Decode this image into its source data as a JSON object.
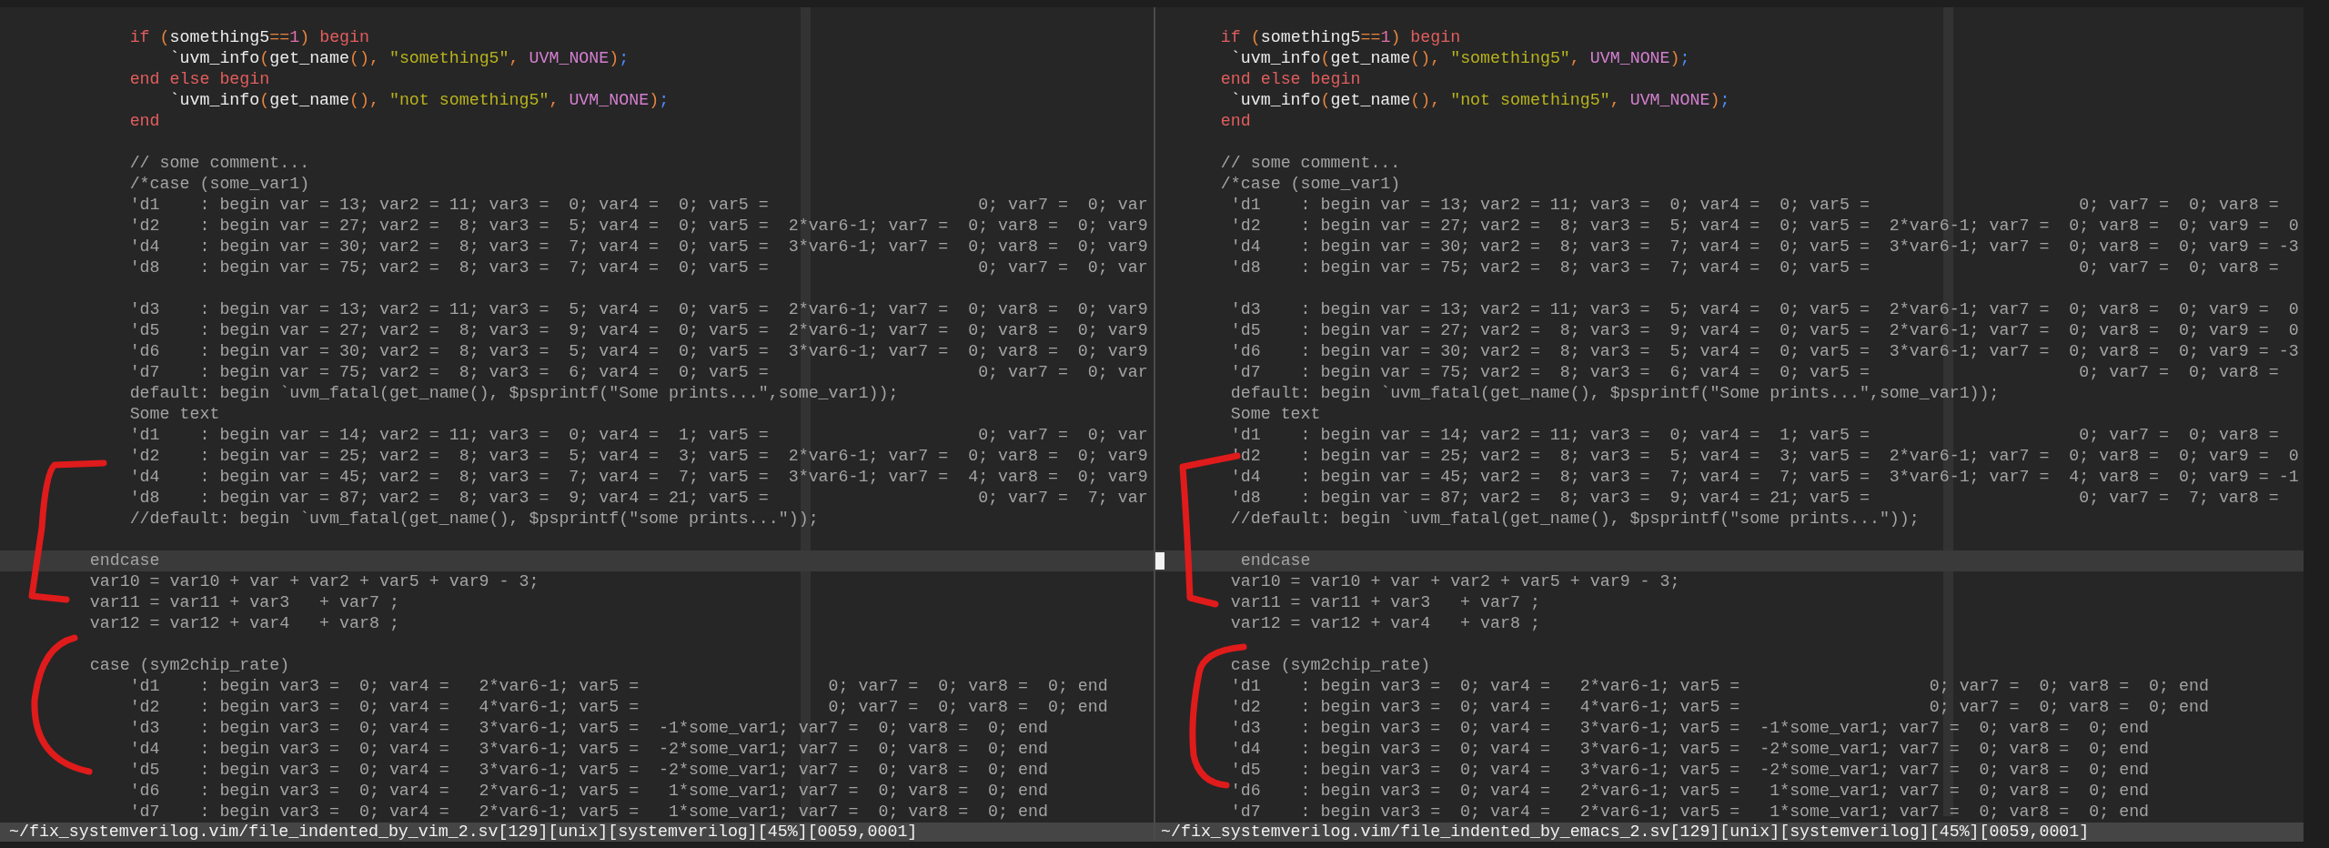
{
  "panes": [
    {
      "active": false,
      "lines": [
        {
          "segments": [
            {
              "text": "            if",
              "kind": "keyword"
            },
            {
              "text": " (",
              "kind": "paren"
            },
            {
              "text": "something5",
              "kind": "ident"
            },
            {
              "text": "==",
              "kind": "paren"
            },
            {
              "text": "1",
              "kind": "number"
            },
            {
              "text": ")",
              "kind": "paren"
            },
            {
              "text": " begin",
              "kind": "keyword"
            }
          ]
        },
        {
          "segments": [
            {
              "text": "                `uvm_info",
              "kind": "ident"
            },
            {
              "text": "(",
              "kind": "paren"
            },
            {
              "text": "get_name",
              "kind": "ident"
            },
            {
              "text": "(),",
              "kind": "paren"
            },
            {
              "text": " \"something5\"",
              "kind": "string"
            },
            {
              "text": ",",
              "kind": "paren"
            },
            {
              "text": " UVM_NONE",
              "kind": "constant"
            },
            {
              "text": ")",
              "kind": "paren"
            },
            {
              "text": ";",
              "kind": "punct"
            }
          ]
        },
        {
          "segments": [
            {
              "text": "            end else begin",
              "kind": "keyword"
            }
          ]
        },
        {
          "segments": [
            {
              "text": "                `uvm_info",
              "kind": "ident"
            },
            {
              "text": "(",
              "kind": "paren"
            },
            {
              "text": "get_name",
              "kind": "ident"
            },
            {
              "text": "(),",
              "kind": "paren"
            },
            {
              "text": " \"not something5\"",
              "kind": "string"
            },
            {
              "text": ",",
              "kind": "paren"
            },
            {
              "text": " UVM_NONE",
              "kind": "constant"
            },
            {
              "text": ")",
              "kind": "paren"
            },
            {
              "text": ";",
              "kind": "punct"
            }
          ]
        },
        {
          "segments": [
            {
              "text": "            end",
              "kind": "keyword"
            }
          ]
        },
        {
          "text": "            // some comment...",
          "blank_before": true
        },
        {
          "text": "            /*case (some_var1)"
        },
        {
          "text": "            'd1    : begin var = 13; var2 = 11; var3 =  0; var4 =  0; var5 =                     0; var7 =  0; var"
        },
        {
          "text": "            'd2    : begin var = 27; var2 =  8; var3 =  5; var4 =  0; var5 =  2*var6-1; var7 =  0; var8 =  0; var9"
        },
        {
          "text": "            'd4    : begin var = 30; var2 =  8; var3 =  7; var4 =  0; var5 =  3*var6-1; var7 =  0; var8 =  0; var9"
        },
        {
          "text": "            'd8    : begin var = 75; var2 =  8; var3 =  7; var4 =  0; var5 =                     0; var7 =  0; var"
        },
        {
          "text": "            'd3    : begin var = 13; var2 = 11; var3 =  5; var4 =  0; var5 =  2*var6-1; var7 =  0; var8 =  0; var9",
          "blank_before": true
        },
        {
          "text": "            'd5    : begin var = 27; var2 =  8; var3 =  9; var4 =  0; var5 =  2*var6-1; var7 =  0; var8 =  0; var9"
        },
        {
          "text": "            'd6    : begin var = 30; var2 =  8; var3 =  5; var4 =  0; var5 =  3*var6-1; var7 =  0; var8 =  0; var9"
        },
        {
          "text": "            'd7    : begin var = 75; var2 =  8; var3 =  6; var4 =  0; var5 =                     0; var7 =  0; var"
        },
        {
          "text": "            default: begin `uvm_fatal(get_name(), $psprintf(\"Some prints...\",some_var1));"
        },
        {
          "text": "            Some text"
        },
        {
          "text": "            'd1    : begin var = 14; var2 = 11; var3 =  0; var4 =  1; var5 =                     0; var7 =  0; var"
        },
        {
          "text": "            'd2    : begin var = 25; var2 =  8; var3 =  5; var4 =  3; var5 =  2*var6-1; var7 =  0; var8 =  0; var9"
        },
        {
          "text": "            'd4    : begin var = 45; var2 =  8; var3 =  7; var4 =  7; var5 =  3*var6-1; var7 =  4; var8 =  0; var9"
        },
        {
          "text": "            'd8    : begin var = 87; var2 =  8; var3 =  9; var4 = 21; var5 =                     0; var7 =  7; var"
        },
        {
          "text": "            //default: begin `uvm_fatal(get_name(), $psprintf(\"some prints...\"));"
        },
        {
          "text": "        endcase",
          "current": true,
          "blank_before": true
        },
        {
          "text": "        var10 = var10 + var + var2 + var5 + var9 - 3;"
        },
        {
          "text": "        var11 = var11 + var3   + var7 ;"
        },
        {
          "text": "        var12 = var12 + var4   + var8 ;"
        },
        {
          "text": "        case (sym2chip_rate)",
          "blank_before": true
        },
        {
          "text": "            'd1    : begin var3 =  0; var4 =   2*var6-1; var5 =                   0; var7 =  0; var8 =  0; end"
        },
        {
          "text": "            'd2    : begin var3 =  0; var4 =   4*var6-1; var5 =                   0; var7 =  0; var8 =  0; end"
        },
        {
          "text": "            'd3    : begin var3 =  0; var4 =   3*var6-1; var5 =  -1*some_var1; var7 =  0; var8 =  0; end"
        },
        {
          "text": "            'd4    : begin var3 =  0; var4 =   3*var6-1; var5 =  -2*some_var1; var7 =  0; var8 =  0; end"
        },
        {
          "text": "            'd5    : begin var3 =  0; var4 =   3*var6-1; var5 =  -2*some_var1; var7 =  0; var8 =  0; end"
        },
        {
          "text": "            'd6    : begin var3 =  0; var4 =   2*var6-1; var5 =   1*some_var1; var7 =  0; var8 =  0; end"
        },
        {
          "text": "            'd7    : begin var3 =  0; var4 =   2*var6-1; var5 =   1*some_var1; var7 =  0; var8 =  0; end"
        }
      ],
      "status": "~/fix_systemverilog.vim/file_indented_by_vim_2.sv[129][unix][systemverilog][45%][0059,0001]"
    },
    {
      "active": true,
      "lines": [
        {
          "segments": [
            {
              "text": "      if",
              "kind": "keyword"
            },
            {
              "text": " (",
              "kind": "paren"
            },
            {
              "text": "something5",
              "kind": "ident"
            },
            {
              "text": "==",
              "kind": "paren"
            },
            {
              "text": "1",
              "kind": "number"
            },
            {
              "text": ")",
              "kind": "paren"
            },
            {
              "text": " begin",
              "kind": "keyword"
            }
          ]
        },
        {
          "segments": [
            {
              "text": "       `uvm_info",
              "kind": "ident"
            },
            {
              "text": "(",
              "kind": "paren"
            },
            {
              "text": "get_name",
              "kind": "ident"
            },
            {
              "text": "(),",
              "kind": "paren"
            },
            {
              "text": " \"something5\"",
              "kind": "string"
            },
            {
              "text": ",",
              "kind": "paren"
            },
            {
              "text": " UVM_NONE",
              "kind": "constant"
            },
            {
              "text": ")",
              "kind": "paren"
            },
            {
              "text": ";",
              "kind": "punct"
            }
          ]
        },
        {
          "segments": [
            {
              "text": "      end else begin",
              "kind": "keyword"
            }
          ]
        },
        {
          "segments": [
            {
              "text": "       `uvm_info",
              "kind": "ident"
            },
            {
              "text": "(",
              "kind": "paren"
            },
            {
              "text": "get_name",
              "kind": "ident"
            },
            {
              "text": "(),",
              "kind": "paren"
            },
            {
              "text": " \"not something5\"",
              "kind": "string"
            },
            {
              "text": ",",
              "kind": "paren"
            },
            {
              "text": " UVM_NONE",
              "kind": "constant"
            },
            {
              "text": ")",
              "kind": "paren"
            },
            {
              "text": ";",
              "kind": "punct"
            }
          ]
        },
        {
          "segments": [
            {
              "text": "      end",
              "kind": "keyword"
            }
          ]
        },
        {
          "text": "      // some comment...",
          "blank_before": true
        },
        {
          "text": "      /*case (some_var1)"
        },
        {
          "text": "       'd1    : begin var = 13; var2 = 11; var3 =  0; var4 =  0; var5 =                     0; var7 =  0; var8 ="
        },
        {
          "text": "       'd2    : begin var = 27; var2 =  8; var3 =  5; var4 =  0; var5 =  2*var6-1; var7 =  0; var8 =  0; var9 =  0"
        },
        {
          "text": "       'd4    : begin var = 30; var2 =  8; var3 =  7; var4 =  0; var5 =  3*var6-1; var7 =  0; var8 =  0; var9 = -3"
        },
        {
          "text": "       'd8    : begin var = 75; var2 =  8; var3 =  7; var4 =  0; var5 =                     0; var7 =  0; var8 ="
        },
        {
          "text": "       'd3    : begin var = 13; var2 = 11; var3 =  5; var4 =  0; var5 =  2*var6-1; var7 =  0; var8 =  0; var9 =  0",
          "blank_before": true
        },
        {
          "text": "       'd5    : begin var = 27; var2 =  8; var3 =  9; var4 =  0; var5 =  2*var6-1; var7 =  0; var8 =  0; var9 =  0"
        },
        {
          "text": "       'd6    : begin var = 30; var2 =  8; var3 =  5; var4 =  0; var5 =  3*var6-1; var7 =  0; var8 =  0; var9 = -3"
        },
        {
          "text": "       'd7    : begin var = 75; var2 =  8; var3 =  6; var4 =  0; var5 =                     0; var7 =  0; var8 ="
        },
        {
          "text": "       default: begin `uvm_fatal(get_name(), $psprintf(\"Some prints...\",some_var1));"
        },
        {
          "text": "       Some text"
        },
        {
          "text": "       'd1    : begin var = 14; var2 = 11; var3 =  0; var4 =  1; var5 =                     0; var7 =  0; var8 ="
        },
        {
          "text": "       'd2    : begin var = 25; var2 =  8; var3 =  5; var4 =  3; var5 =  2*var6-1; var7 =  0; var8 =  0; var9 =  0"
        },
        {
          "text": "       'd4    : begin var = 45; var2 =  8; var3 =  7; var4 =  7; var5 =  3*var6-1; var7 =  4; var8 =  0; var9 = -1"
        },
        {
          "text": "       'd8    : begin var = 87; var2 =  8; var3 =  9; var4 = 21; var5 =                     0; var7 =  7; var8 ="
        },
        {
          "text": "       //default: begin `uvm_fatal(get_name(), $psprintf(\"some prints...\"));"
        },
        {
          "text": "        endcase",
          "current": true,
          "blank_before": true
        },
        {
          "text": "       var10 = var10 + var + var2 + var5 + var9 - 3;"
        },
        {
          "text": "       var11 = var11 + var3   + var7 ;"
        },
        {
          "text": "       var12 = var12 + var4   + var8 ;"
        },
        {
          "text": "       case (sym2chip_rate)",
          "blank_before": true
        },
        {
          "text": "       'd1    : begin var3 =  0; var4 =   2*var6-1; var5 =                   0; var7 =  0; var8 =  0; end"
        },
        {
          "text": "       'd2    : begin var3 =  0; var4 =   4*var6-1; var5 =                   0; var7 =  0; var8 =  0; end"
        },
        {
          "text": "       'd3    : begin var3 =  0; var4 =   3*var6-1; var5 =  -1*some_var1; var7 =  0; var8 =  0; end"
        },
        {
          "text": "       'd4    : begin var3 =  0; var4 =   3*var6-1; var5 =  -2*some_var1; var7 =  0; var8 =  0; end"
        },
        {
          "text": "       'd5    : begin var3 =  0; var4 =   3*var6-1; var5 =  -2*some_var1; var7 =  0; var8 =  0; end"
        },
        {
          "text": "       'd6    : begin var3 =  0; var4 =   2*var6-1; var5 =   1*some_var1; var7 =  0; var8 =  0; end"
        },
        {
          "text": "       'd7    : begin var3 =  0; var4 =   2*var6-1; var5 =   1*some_var1; var7 =  0; var8 =  0; end"
        }
      ],
      "status": "~/fix_systemverilog.vim/file_indented_by_emacs_2.sv[129][unix][systemverilog][45%][0059,0001]"
    }
  ]
}
